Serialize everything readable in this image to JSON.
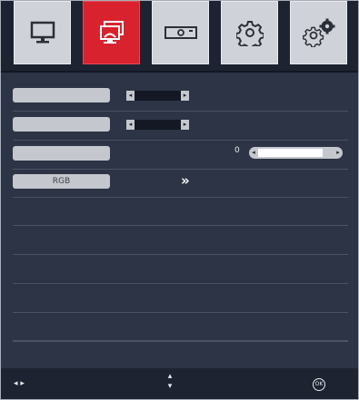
{
  "tabs": [
    {
      "name": "tab-picture",
      "icon": "monitor-icon",
      "active": false
    },
    {
      "name": "tab-screen",
      "icon": "screens-icon",
      "active": true
    },
    {
      "name": "tab-projector",
      "icon": "projector-icon",
      "active": false
    },
    {
      "name": "tab-settings",
      "icon": "gear-icon",
      "active": false
    },
    {
      "name": "tab-advanced-settings",
      "icon": "gears-icon",
      "active": false
    }
  ],
  "rows": [
    {
      "label": "",
      "control": "selector",
      "value": ""
    },
    {
      "label": "",
      "control": "selector",
      "value": ""
    },
    {
      "label": "",
      "control": "slider",
      "value": "0",
      "level": 0.85
    },
    {
      "label": "RGB",
      "control": "submenu",
      "value": "»"
    },
    {
      "label": "",
      "control": "none"
    },
    {
      "label": "",
      "control": "none"
    },
    {
      "label": "",
      "control": "none"
    },
    {
      "label": "",
      "control": "none"
    },
    {
      "label": "",
      "control": "none"
    },
    {
      "label": "",
      "control": "none"
    }
  ],
  "footer": {
    "left_hint": "◂ ▸",
    "center_hint": "▴ ▾",
    "ok_label": "OK"
  },
  "colors": {
    "background": "#2d3445",
    "bar": "#1d2330",
    "active_tab": "#d8232f",
    "inactive_tab": "#cfd2d8"
  }
}
